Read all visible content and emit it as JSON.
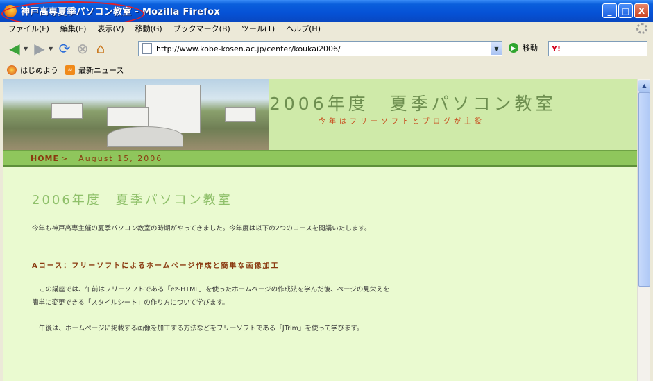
{
  "window": {
    "title": "神戸高専夏季パソコン教室 - Mozilla Firefox",
    "minimize": "_",
    "maximize": "□",
    "close": "X"
  },
  "menu": [
    "ファイル(F)",
    "編集(E)",
    "表示(V)",
    "移動(G)",
    "ブックマーク(B)",
    "ツール(T)",
    "ヘルプ(H)"
  ],
  "toolbar": {
    "url": "http://www.kobe-kosen.ac.jp/center/koukai2006/",
    "go_label": "移動",
    "search_placeholder": ""
  },
  "bookmarks": [
    "はじめよう",
    "最新ニュース"
  ],
  "page": {
    "site_title": "2006年度　夏季パソコン教室",
    "site_subtitle": "今年はフリーソフトとブログが主役",
    "nav_home": "HOME",
    "nav_arrow": ">",
    "nav_date": "August 15, 2006",
    "heading": "2006年度　夏季パソコン教室",
    "intro": "今年も神戸高専主催の夏季パソコン教室の時期がやってきました。今年度は以下の2つのコースを開講いたします。",
    "course_a_title": "Aコース：フリーソフトによるホームページ作成と簡単な画像加工",
    "course_a_p1": "この講座では、午前はフリーソフトである「ez-HTML」を使ったホームページの作成法を学んだ後、ページの見栄えを簡単に変更できる「スタイルシート」の作り方について学びます。",
    "course_a_p2": "午後は、ホームページに掲載する画像を加工する方法などをフリーソフトである「JTrim」を使って学びます。"
  },
  "colors": {
    "titlebar": "#0652d6",
    "page_bg": "#eafad0",
    "header_bg": "#cfeaa9",
    "nav_strip": "#8fc65c",
    "accent_brown": "#8a3a10",
    "title_green": "#6e8f50",
    "highlight_ellipse": "#e0202a"
  }
}
